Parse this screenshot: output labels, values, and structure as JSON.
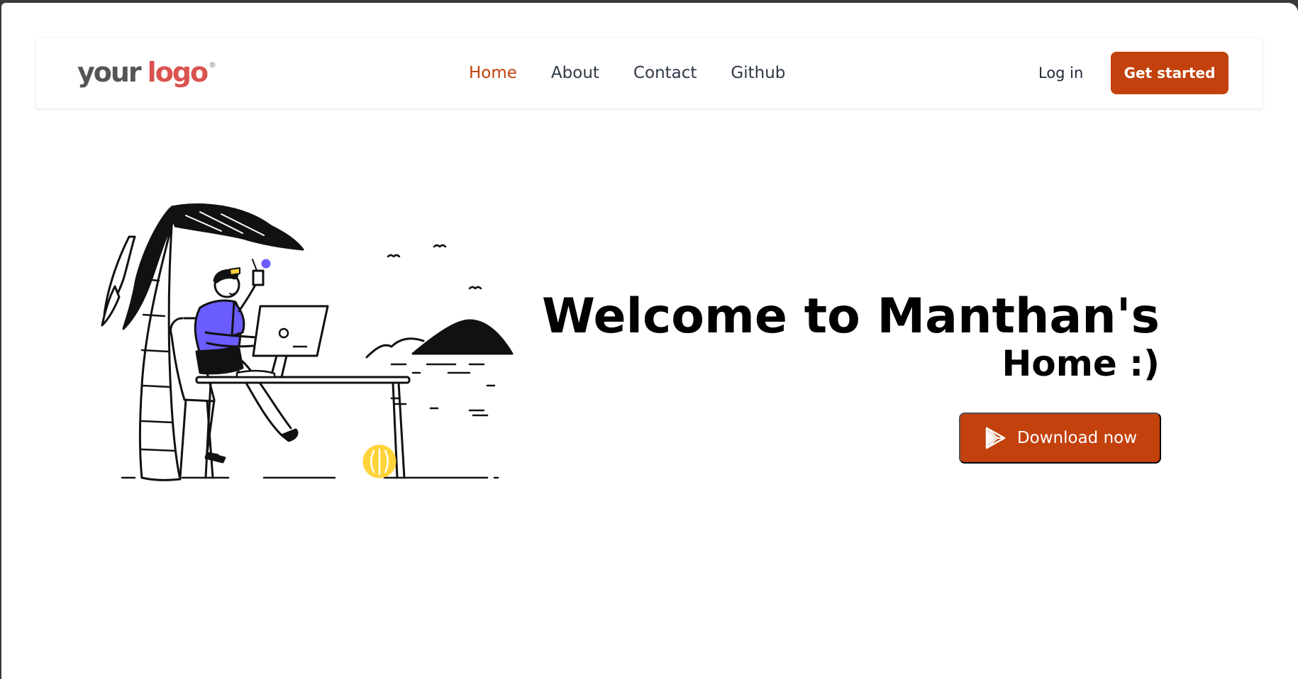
{
  "brand": {
    "logo_word1": "your",
    "logo_word2": "logo",
    "logo_mark": "®"
  },
  "nav": {
    "links": [
      {
        "label": "Home",
        "active": true
      },
      {
        "label": "About",
        "active": false
      },
      {
        "label": "Contact",
        "active": false
      },
      {
        "label": "Github",
        "active": false
      }
    ],
    "login_label": "Log in",
    "cta_label": "Get started"
  },
  "hero": {
    "title": "Welcome to Manthan's",
    "subtitle": "Home :)",
    "download_label": "Download now",
    "download_icon": "play-store-icon",
    "illustration": "person-working-on-beach-illustration"
  },
  "colors": {
    "accent": "#c2410c",
    "nav_text": "#2f3846",
    "logo_your": "#555555",
    "logo_logo": "#d9534f",
    "shirt": "#6b5cff",
    "ball": "#ffd43b"
  }
}
